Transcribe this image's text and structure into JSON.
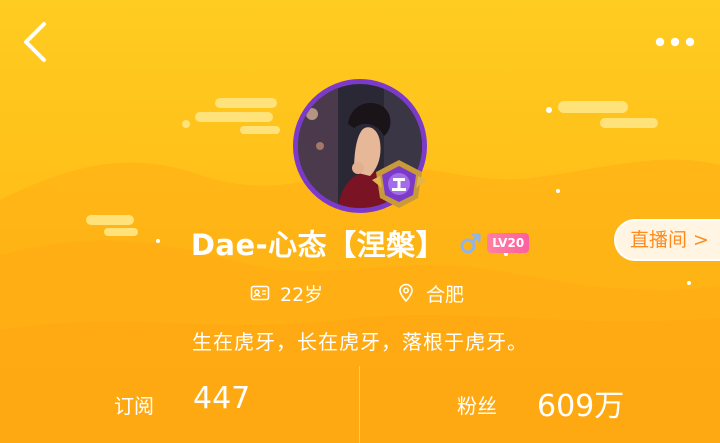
{
  "colors": {
    "background": "#ffbf18",
    "avatar_ring": "#7b3bc8",
    "level_badge": "#ff6fa0",
    "live_button_text": "#ff8a1d"
  },
  "header": {
    "back_icon": "chevron-left-icon",
    "more_icon": "more-dots-icon"
  },
  "profile": {
    "username": "Dae-心态【涅槃】",
    "gender_icon": "male-icon",
    "level": "LV20",
    "rank_badge_icon": "purple-crest-icon",
    "live_room_label": "直播间 >",
    "age": "22岁",
    "age_icon": "id-card-icon",
    "city": "合肥",
    "city_icon": "location-pin-icon",
    "bio": "生在虎牙，长在虎牙，落根于虎牙。"
  },
  "stats": {
    "subscriptions": {
      "label": "订阅",
      "value": "447"
    },
    "fans": {
      "label": "粉丝",
      "value": "609万"
    }
  }
}
